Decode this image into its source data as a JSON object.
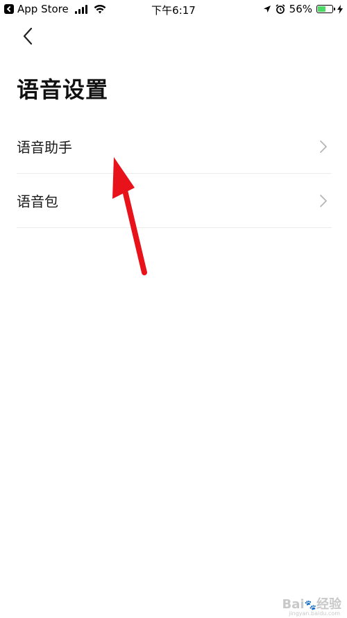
{
  "status_bar": {
    "back_app_label": "App Store",
    "time": "下午6:17",
    "battery_percent": "56%",
    "battery_level": 0.56,
    "battery_color": "#4cd964",
    "icons": [
      "signal-icon",
      "wifi-icon",
      "location-icon",
      "alarm-icon",
      "battery-icon",
      "charging-icon"
    ]
  },
  "nav": {
    "back_icon": "chevron-left-icon"
  },
  "page": {
    "title": "语音设置"
  },
  "settings": {
    "items": [
      {
        "label": "语音助手",
        "icon": "chevron-right-icon"
      },
      {
        "label": "语音包",
        "icon": "chevron-right-icon"
      }
    ]
  },
  "annotation": {
    "arrow_color": "#e8121b",
    "icon": "red-arrow-icon"
  },
  "watermark": {
    "text": "Bai 经验",
    "sub": "jingyan.baidu.com"
  }
}
